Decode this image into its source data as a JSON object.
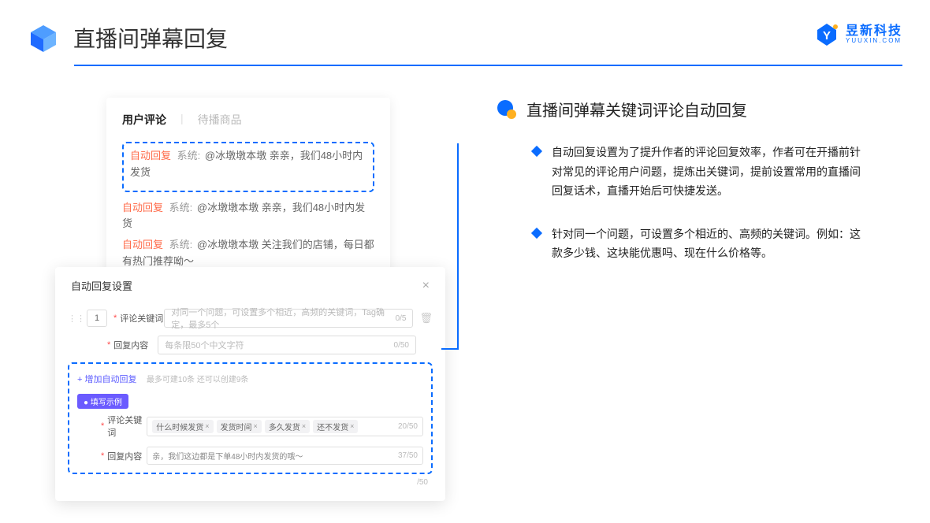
{
  "header": {
    "title": "直播间弹幕回复",
    "brand_cn": "昱新科技",
    "brand_en": "YUUXIN.COM"
  },
  "left": {
    "tabs": {
      "active": "用户评论",
      "inactive": "待播商品"
    },
    "comments": {
      "auto_label": "自动回复",
      "sys_label": "系统:",
      "c1": "@冰墩墩本墩 亲亲，我们48小时内发货",
      "c2": "@冰墩墩本墩 亲亲，我们48小时内发货",
      "c3": "@冰墩墩本墩 关注我们的店铺，每日都有热门推荐呦～"
    },
    "modal": {
      "title": "自动回复设置",
      "num": "1",
      "label_keyword": "评论关键词",
      "ph_keyword": "对同一个问题，可设置多个相近，高频的关键词，Tag确定，最多5个",
      "count_keyword": "0/5",
      "label_reply": "回复内容",
      "ph_reply": "每条限50个中文字符",
      "count_reply": "0/50",
      "add_text": "+ 增加自动回复",
      "add_hint": "最多可建10条 还可以创建9条",
      "example_badge": "● 填写示例",
      "ex_kw_label": "评论关键词",
      "ex_tags": [
        "什么时候发货",
        "发货时间",
        "多久发货",
        "还不发货"
      ],
      "ex_kw_count": "20/50",
      "ex_reply_label": "回复内容",
      "ex_reply_text": "亲，我们这边都是下单48小时内发货的哦～",
      "ex_reply_count": "37/50",
      "outer_count": "/50"
    }
  },
  "right": {
    "title": "直播间弹幕关键词评论自动回复",
    "p1": "自动回复设置为了提升作者的评论回复效率，作者可在开播前针对常见的评论用户问题，提炼出关键词，提前设置常用的直播间回复话术，直播开始后可快捷发送。",
    "p2": "针对同一个问题，可设置多个相近的、高频的关键词。例如：这款多少钱、这块能优惠吗、现在什么价格等。"
  }
}
